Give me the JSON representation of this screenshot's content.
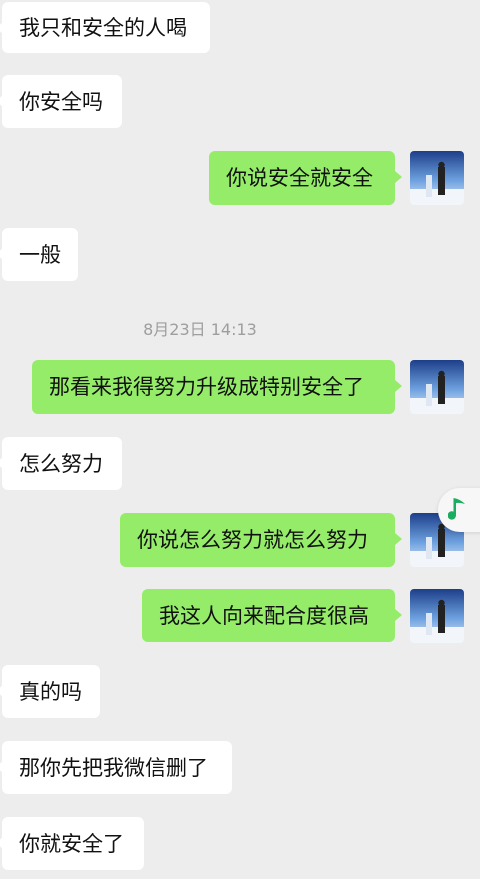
{
  "messages": [
    {
      "side": "left",
      "text": "我只和安全的人喝"
    },
    {
      "side": "left",
      "text": "你安全吗"
    },
    {
      "side": "right",
      "text": "你说安全就安全"
    },
    {
      "side": "left",
      "text": "一般"
    },
    {
      "side": "right",
      "text": "那看来我得努力升级成特别安全了"
    },
    {
      "side": "left",
      "text": "怎么努力"
    },
    {
      "side": "right",
      "text": "你说怎么努力就怎么努力"
    },
    {
      "side": "right",
      "text": "我这人向来配合度很高"
    },
    {
      "side": "left",
      "text": "真的吗"
    },
    {
      "side": "left",
      "text": "那你先把我微信删了"
    },
    {
      "side": "left",
      "text": "你就安全了"
    }
  ],
  "timestamp": "8月23日 14:13",
  "floating_widget": {
    "icon": "music-note-icon",
    "color": "#1aad5f"
  },
  "colors": {
    "background": "#ededed",
    "incoming_bubble": "#ffffff",
    "outgoing_bubble": "#95ec69"
  }
}
